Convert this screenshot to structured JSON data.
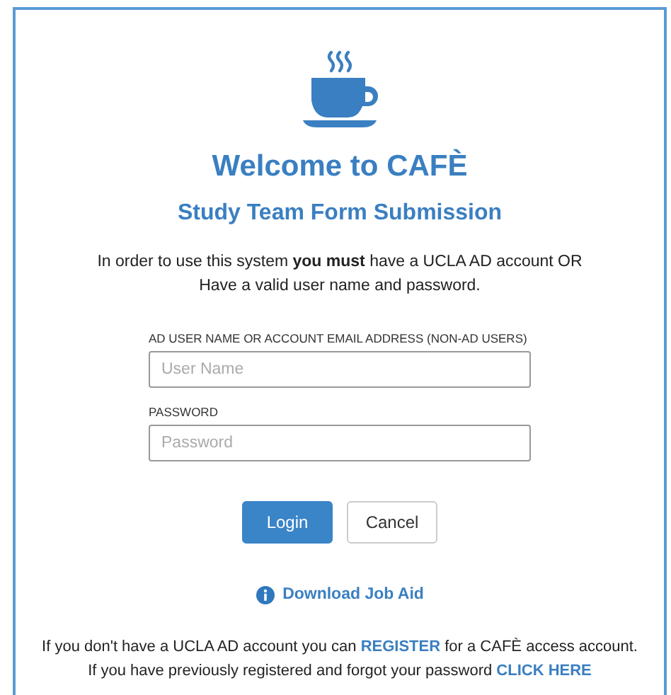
{
  "title": "Welcome to CAFÈ",
  "subtitle": "Study Team Form Submission",
  "intro": [
    "In order to use this system **you must** have a UCLA AD account OR",
    "Have a valid user name and password."
  ],
  "fields": [
    {
      "label": "AD USER NAME OR ACCOUNT EMAIL ADDRESS (NON-AD USERS)",
      "placeholder": "User Name"
    },
    {
      "label": "PASSWORD",
      "placeholder": "Password"
    }
  ],
  "buttons": [
    {
      "label": "Login",
      "kind": "primary"
    },
    {
      "label": "Cancel",
      "kind": "secondary"
    }
  ],
  "job_aid_link": "Download Job Aid",
  "footer": [
    {
      "before": "If you don't have a UCLA AD account you can ",
      "link": "REGISTER",
      "after": " for a CAFÈ access account."
    },
    {
      "before": "If you have previously registered and forgot your password ",
      "link": "CLICK HERE"
    }
  ]
}
